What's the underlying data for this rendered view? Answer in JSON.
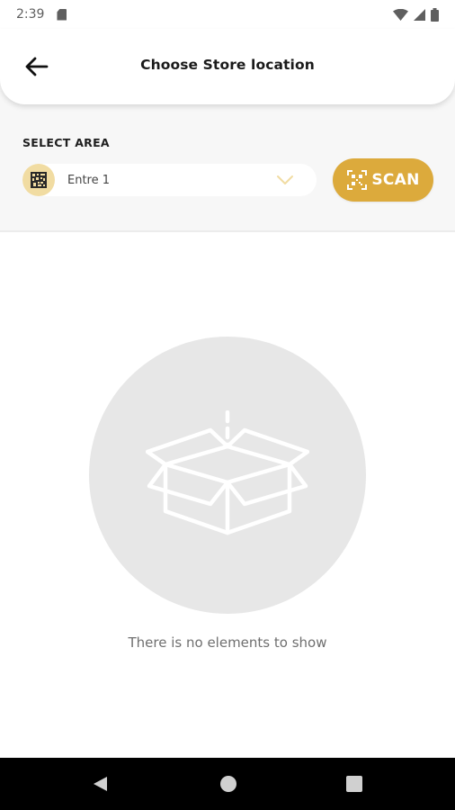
{
  "status_bar": {
    "time": "2:39"
  },
  "header": {
    "title": "Choose Store location",
    "back_icon": "arrow-left-icon"
  },
  "area": {
    "label": "SELECT AREA",
    "selected": "Entre 1",
    "scan_label": "SCAN"
  },
  "empty_state": {
    "message": "There is no elements to show",
    "icon": "open-box-icon"
  },
  "colors": {
    "accent": "#dcaa3c",
    "accent_light": "#f1dca2",
    "empty_circle": "#e7e7e7"
  }
}
